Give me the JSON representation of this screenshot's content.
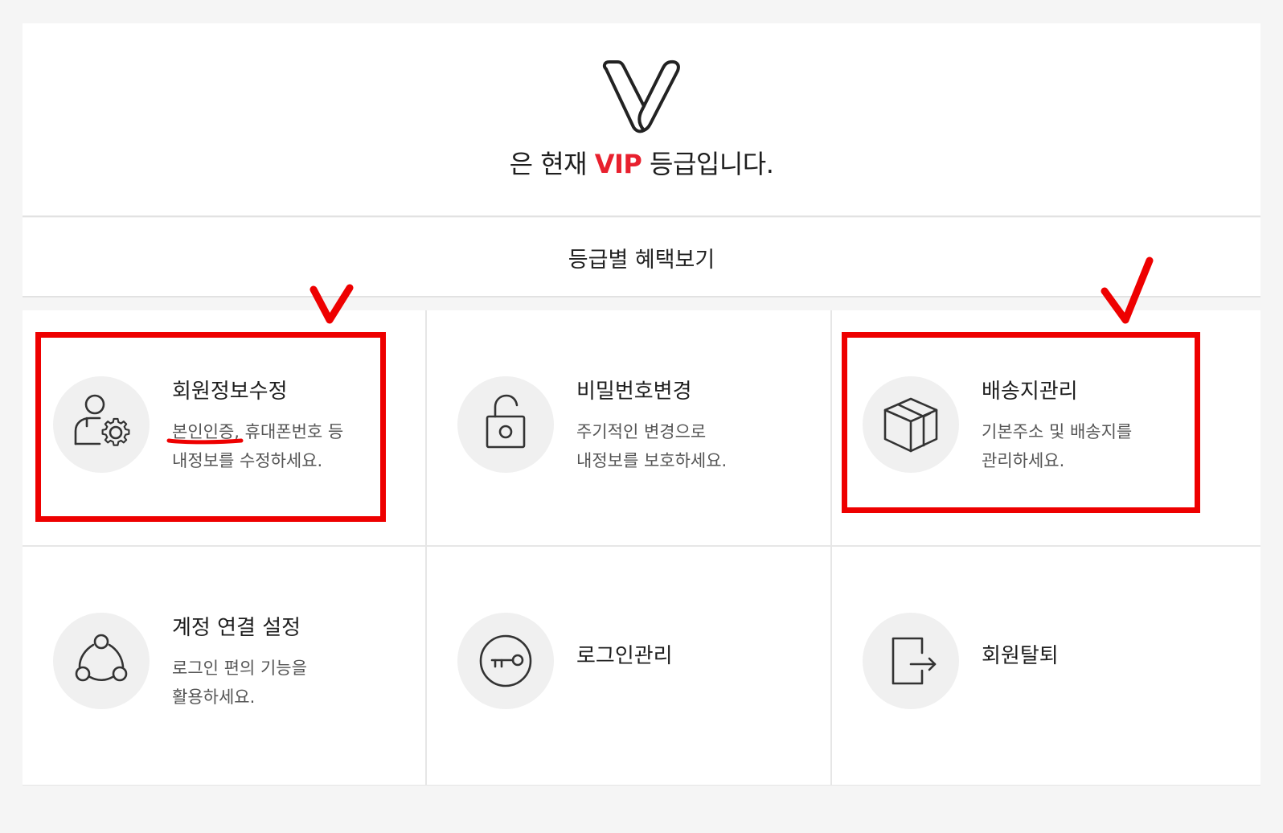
{
  "grade": {
    "prefix": "은 현재 ",
    "level": "VIP",
    "suffix": " 등급입니다."
  },
  "benefits": {
    "label": "등급별 혜택보기"
  },
  "menu": [
    {
      "title": "회원정보수정",
      "desc_line1_highlight": "본인인증",
      "desc_line1_rest": ", 휴대폰번호 등",
      "desc_line2": "내정보를 수정하세요.",
      "icon": "user-gear-icon"
    },
    {
      "title": "비밀번호변경",
      "desc_line1": "주기적인 변경으로",
      "desc_line2": "내정보를 보호하세요.",
      "icon": "unlock-icon"
    },
    {
      "title": "배송지관리",
      "desc_line1": "기본주소 및 배송지를",
      "desc_line2": "관리하세요.",
      "icon": "package-box-icon"
    },
    {
      "title": "계정 연결 설정",
      "desc_line1": "로그인 편의 기능을",
      "desc_line2": "활용하세요.",
      "icon": "connected-nodes-icon"
    },
    {
      "title": "로그인관리",
      "icon": "key-icon"
    },
    {
      "title": "회원탈퇴",
      "icon": "logout-door-icon"
    }
  ],
  "colors": {
    "accent": "#e8202e",
    "annotation": "#ee0000",
    "icon_background": "#f0f0f0",
    "page_background": "#f5f5f5"
  }
}
